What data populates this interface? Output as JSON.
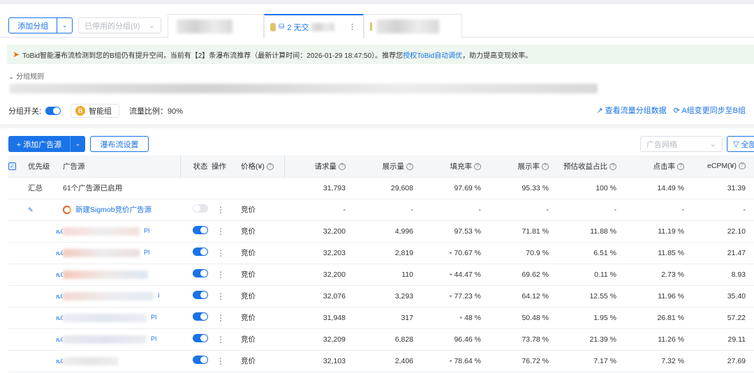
{
  "toolbar": {
    "add_group": "添加分组",
    "disabled_groups": "已停用的分组(9)",
    "active_tab": "2 无交",
    "tab_more": "⋮"
  },
  "notice": {
    "text_before": "ToBid智能瀑布流检测到您的B组仍有提升空间，当前有【2】条瀑布流推荐（最新计算时间：2026-01-29 18:47:50）。推荐您",
    "link": "授权ToBid自动调优",
    "text_after": "，助力提高变现效率。"
  },
  "rules": {
    "label": "分组规则"
  },
  "group": {
    "switch_label": "分组开关:",
    "smart_badge": "B",
    "smart_label": "智能组",
    "ratio": "流量比例：90%",
    "link_data": "查看流量分组数据",
    "link_sync": "A组变更同步至B组"
  },
  "main_toolbar": {
    "add_source": "+ 添加广告源",
    "waterfall_settings": "瀑布流设置",
    "network_placeholder": "广告网络",
    "filter": "全部"
  },
  "table": {
    "headers": [
      "优先级",
      "广告源",
      "状态",
      "操作",
      "价格(¥)",
      "请求量",
      "展示量",
      "填充率",
      "展示率",
      "预估收益占比",
      "点击率",
      "eCPM(¥)"
    ],
    "summary": {
      "label": "汇总",
      "desc": "61个广告源已启用",
      "requests": "31,793",
      "impressions": "29,608",
      "fill": "97.69 %",
      "show": "95.33 %",
      "share": "100 %",
      "ctr": "14.49 %",
      "ecpm": "31.39"
    },
    "new_row": {
      "name": "新建Sigmob竞价广告源",
      "price": "竞价",
      "requests": "-",
      "impressions": "-",
      "fill": "-",
      "show": "-",
      "share": "-",
      "ctr": "-",
      "ecpm": "-"
    },
    "rows": [
      {
        "prio": "ጼC",
        "tag": "PI",
        "price": "竞价",
        "requests": "32,200",
        "impressions": "4,996",
        "fill": "97.53 %",
        "fill_dot": "",
        "show": "71.81 %",
        "share": "11.88 %",
        "ctr": "11.19 %",
        "ecpm": "22.10"
      },
      {
        "prio": "ጼC",
        "tag": "PI",
        "price": "竞价",
        "requests": "32,203",
        "impressions": "2,819",
        "fill": "70.67 %",
        "fill_dot": "•",
        "show": "70.9 %",
        "share": "6.51 %",
        "ctr": "11.85 %",
        "ecpm": "21.47"
      },
      {
        "prio": "ጼC",
        "tag": "",
        "price": "竞价",
        "requests": "32,200",
        "impressions": "110",
        "fill": "44.47 %",
        "fill_dot": "•",
        "show": "69.62 %",
        "share": "0.11 %",
        "ctr": "2.73 %",
        "ecpm": "8.93"
      },
      {
        "prio": "ጼC",
        "tag": "I",
        "price": "竞价",
        "requests": "32,076",
        "impressions": "3,293",
        "fill": "77.23 %",
        "fill_dot": "•",
        "show": "64.12 %",
        "share": "12.55 %",
        "ctr": "11.96 %",
        "ecpm": "35.40"
      },
      {
        "prio": "ጼC",
        "tag": "PI",
        "price": "竞价",
        "requests": "31,948",
        "impressions": "317",
        "fill": "48 %",
        "fill_dot": "•",
        "show": "50.48 %",
        "share": "1.95 %",
        "ctr": "26.81 %",
        "ecpm": "57.22"
      },
      {
        "prio": "ጼC",
        "tag": "PI",
        "price": "竞价",
        "requests": "32,209",
        "impressions": "6,828",
        "fill": "96.46 %",
        "fill_dot": "",
        "show": "73.78 %",
        "share": "21.39 %",
        "ctr": "11.26 %",
        "ecpm": "29.11"
      },
      {
        "prio": "ጼC",
        "tag": "",
        "price": "竞价",
        "requests": "32,103",
        "impressions": "2,406",
        "fill": "78.64 %",
        "fill_dot": "•",
        "show": "76.72 %",
        "share": "7.17 %",
        "ctr": "7.32 %",
        "ecpm": "27.69"
      }
    ]
  },
  "colors": {
    "accent": "#1a73e8",
    "notice_bg": "#eef7ee",
    "badge_orange": "#f5a623"
  }
}
